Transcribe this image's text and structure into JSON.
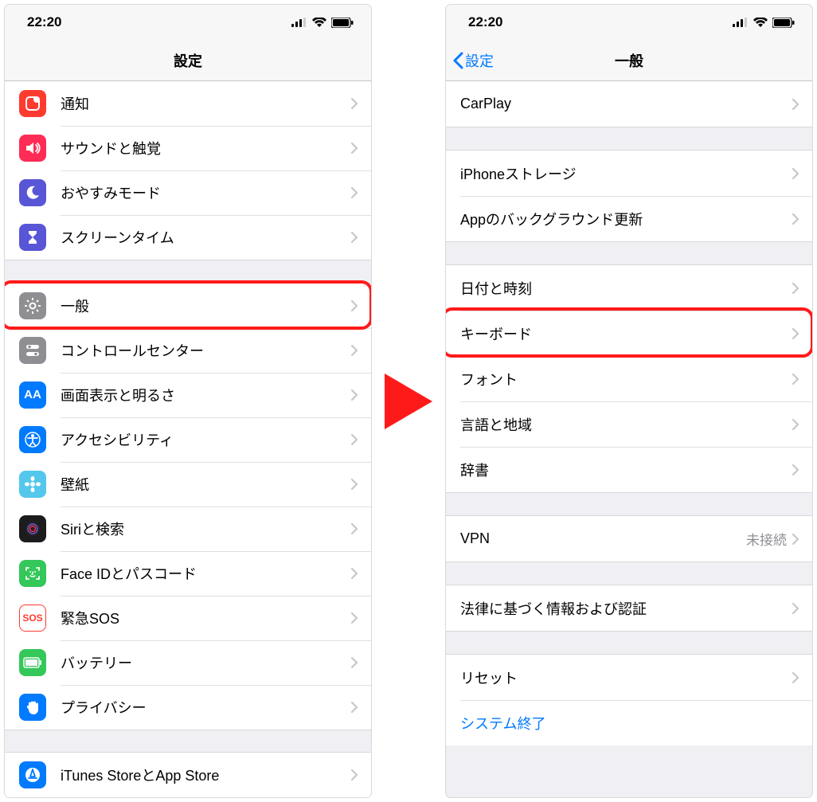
{
  "status": {
    "time": "22:20"
  },
  "left": {
    "title": "設定",
    "groups": [
      [
        {
          "id": "notifications",
          "label": "通知",
          "icon": "notification-icon",
          "bg": "bg-red"
        },
        {
          "id": "sounds",
          "label": "サウンドと触覚",
          "icon": "sound-icon",
          "bg": "bg-pink"
        },
        {
          "id": "dnd",
          "label": "おやすみモード",
          "icon": "moon-icon",
          "bg": "bg-purple"
        },
        {
          "id": "screentime",
          "label": "スクリーンタイム",
          "icon": "hourglass-icon",
          "bg": "bg-purple"
        }
      ],
      [
        {
          "id": "general",
          "label": "一般",
          "icon": "gear-icon",
          "bg": "bg-gray",
          "highlight": true
        },
        {
          "id": "control-center",
          "label": "コントロールセンター",
          "icon": "switches-icon",
          "bg": "bg-gray"
        },
        {
          "id": "display",
          "label": "画面表示と明るさ",
          "icon": "aa-icon",
          "bg": "bg-blue",
          "text": "AA"
        },
        {
          "id": "accessibility",
          "label": "アクセシビリティ",
          "icon": "accessibility-icon",
          "bg": "bg-blue"
        },
        {
          "id": "wallpaper",
          "label": "壁紙",
          "icon": "flower-icon",
          "bg": "bg-teal"
        },
        {
          "id": "siri",
          "label": "Siriと検索",
          "icon": "siri-icon",
          "bg": "bg-black"
        },
        {
          "id": "faceid",
          "label": "Face IDとパスコード",
          "icon": "faceid-icon",
          "bg": "bg-green"
        },
        {
          "id": "sos",
          "label": "緊急SOS",
          "icon": "sos-icon",
          "bg": "bg-sos",
          "text": "SOS"
        },
        {
          "id": "battery",
          "label": "バッテリー",
          "icon": "battery-icon",
          "bg": "bg-green"
        },
        {
          "id": "privacy",
          "label": "プライバシー",
          "icon": "hand-icon",
          "bg": "bg-blue"
        }
      ],
      [
        {
          "id": "itunes",
          "label": "iTunes StoreとApp Store",
          "icon": "appstore-icon",
          "bg": "bg-blue"
        }
      ]
    ]
  },
  "right": {
    "back": "設定",
    "title": "一般",
    "groups": [
      [
        {
          "id": "carplay",
          "label": "CarPlay"
        }
      ],
      [
        {
          "id": "storage",
          "label": "iPhoneストレージ"
        },
        {
          "id": "bg-refresh",
          "label": "Appのバックグラウンド更新"
        }
      ],
      [
        {
          "id": "datetime",
          "label": "日付と時刻"
        },
        {
          "id": "keyboard",
          "label": "キーボード",
          "highlight": true
        },
        {
          "id": "fonts",
          "label": "フォント"
        },
        {
          "id": "language",
          "label": "言語と地域"
        },
        {
          "id": "dictionary",
          "label": "辞書"
        }
      ],
      [
        {
          "id": "vpn",
          "label": "VPN",
          "detail": "未接続"
        }
      ],
      [
        {
          "id": "legal",
          "label": "法律に基づく情報および認証"
        }
      ],
      [
        {
          "id": "reset",
          "label": "リセット"
        },
        {
          "id": "shutdown",
          "label": "システム終了",
          "link": true,
          "nochev": true
        }
      ]
    ]
  }
}
